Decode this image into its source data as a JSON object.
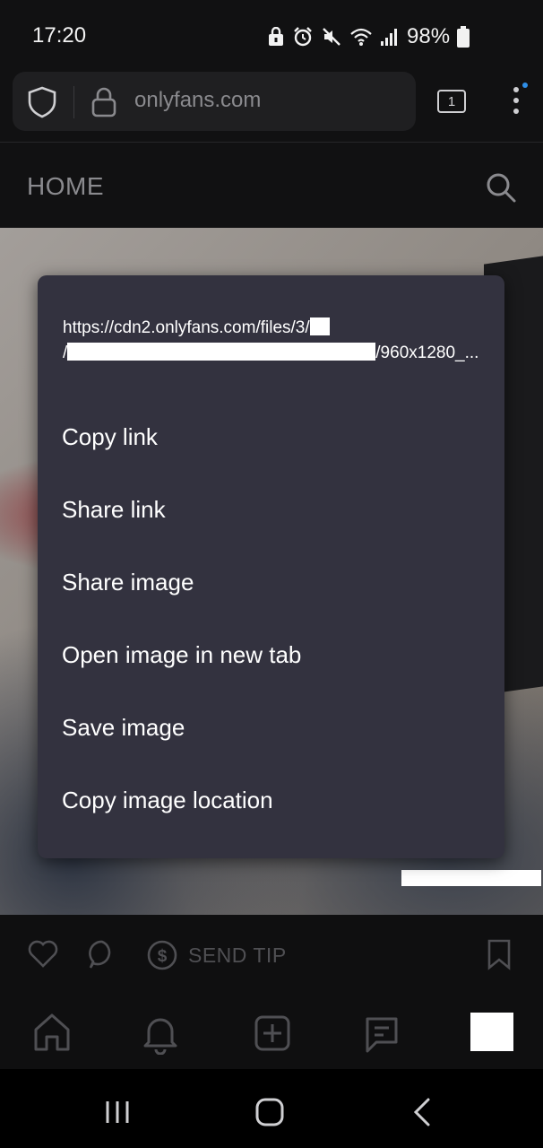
{
  "status_bar": {
    "time": "17:20",
    "battery": "98%",
    "icons": [
      "lock-icon",
      "alarm-icon",
      "mute-icon",
      "wifi-icon",
      "signal-icon",
      "battery-icon"
    ]
  },
  "browser": {
    "url": "onlyfans.com",
    "tab_count": "1"
  },
  "site": {
    "title": "HOME"
  },
  "context_menu": {
    "url_line1": "https://cdn2.onlyfans.com/files/3/",
    "url_line2_prefix": "/",
    "url_line2_suffix": "/960x1280_...",
    "items": [
      "Copy link",
      "Share link",
      "Share image",
      "Open image in new tab",
      "Save image",
      "Copy image location"
    ]
  },
  "post_actions": {
    "send_tip": "SEND TIP"
  },
  "colors": {
    "background": "#111112",
    "menu_bg": "#33323f",
    "muted_text": "#8a8a8e",
    "dot_accent": "#2f8fe8"
  }
}
